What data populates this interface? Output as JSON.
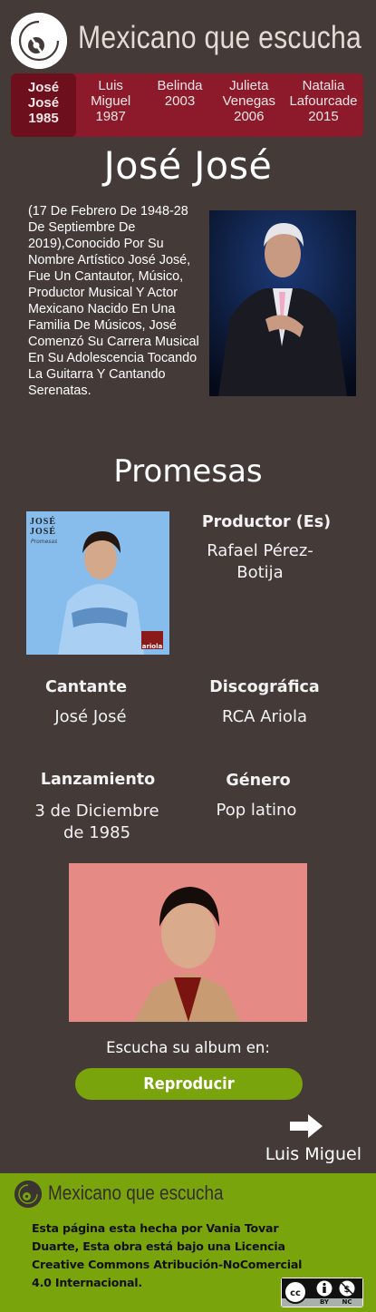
{
  "header": {
    "title": "Mexicano que escucha",
    "logo_icon": "vinyl-disc-icon"
  },
  "nav": {
    "items": [
      {
        "line1": "José José",
        "line2": "1985",
        "active": true
      },
      {
        "line1": "Luis Miguel",
        "line2": "1987",
        "active": false
      },
      {
        "line1": "Belinda",
        "line2": "2003",
        "active": false
      },
      {
        "line1": "Julieta Venegas",
        "line2": "2006",
        "active": false
      },
      {
        "line1": "Natalia Lafourcade",
        "line2": "2015",
        "active": false
      }
    ]
  },
  "artist": {
    "name": "José José",
    "bio": "(17 De Febrero De 1948-28 De Septiembre De 2019),Conocido Por Su Nombre Artístico José José, Fue Un Cantautor, Músico, Productor Musical Y Actor Mexicano Nacido En Una Familia De Músicos, José Comenzó Su Carrera Musical En Su Adolescencia Tocando La Guitarra Y Cantando Serenatas."
  },
  "album": {
    "title": "Promesas",
    "cover_text": "JOSÉ JOSÉ",
    "cover_subtitle": "Promesas",
    "cover_label": "ariola",
    "producer_label": "Productor (Es)",
    "producer_value": "Rafael Pérez-Botija",
    "singer_label": "Cantante",
    "singer_value": "José José",
    "label_label": "Discográfica",
    "label_value": "RCA Ariola",
    "release_label": "Lanzamiento",
    "release_value": "3 de Diciembre de 1985",
    "genre_label": "Género",
    "genre_value": "Pop latino"
  },
  "listen": {
    "text": "Escucha su album en:",
    "button": "Reproducir"
  },
  "next": {
    "label": "Luis Miguel",
    "icon": "arrow-right-icon"
  },
  "footer": {
    "title": "Mexicano que escucha",
    "text": "Esta página esta hecha por Vania Tovar Duarte, Esta obra está bajo una Licencia Creative Commons Atribución-NoComercial 4.0 Internacional.",
    "badge_by": "BY",
    "badge_nc": "NC"
  },
  "colors": {
    "background": "#443b38",
    "nav": "#8c1a2a",
    "accent_green": "#7aa40b"
  }
}
